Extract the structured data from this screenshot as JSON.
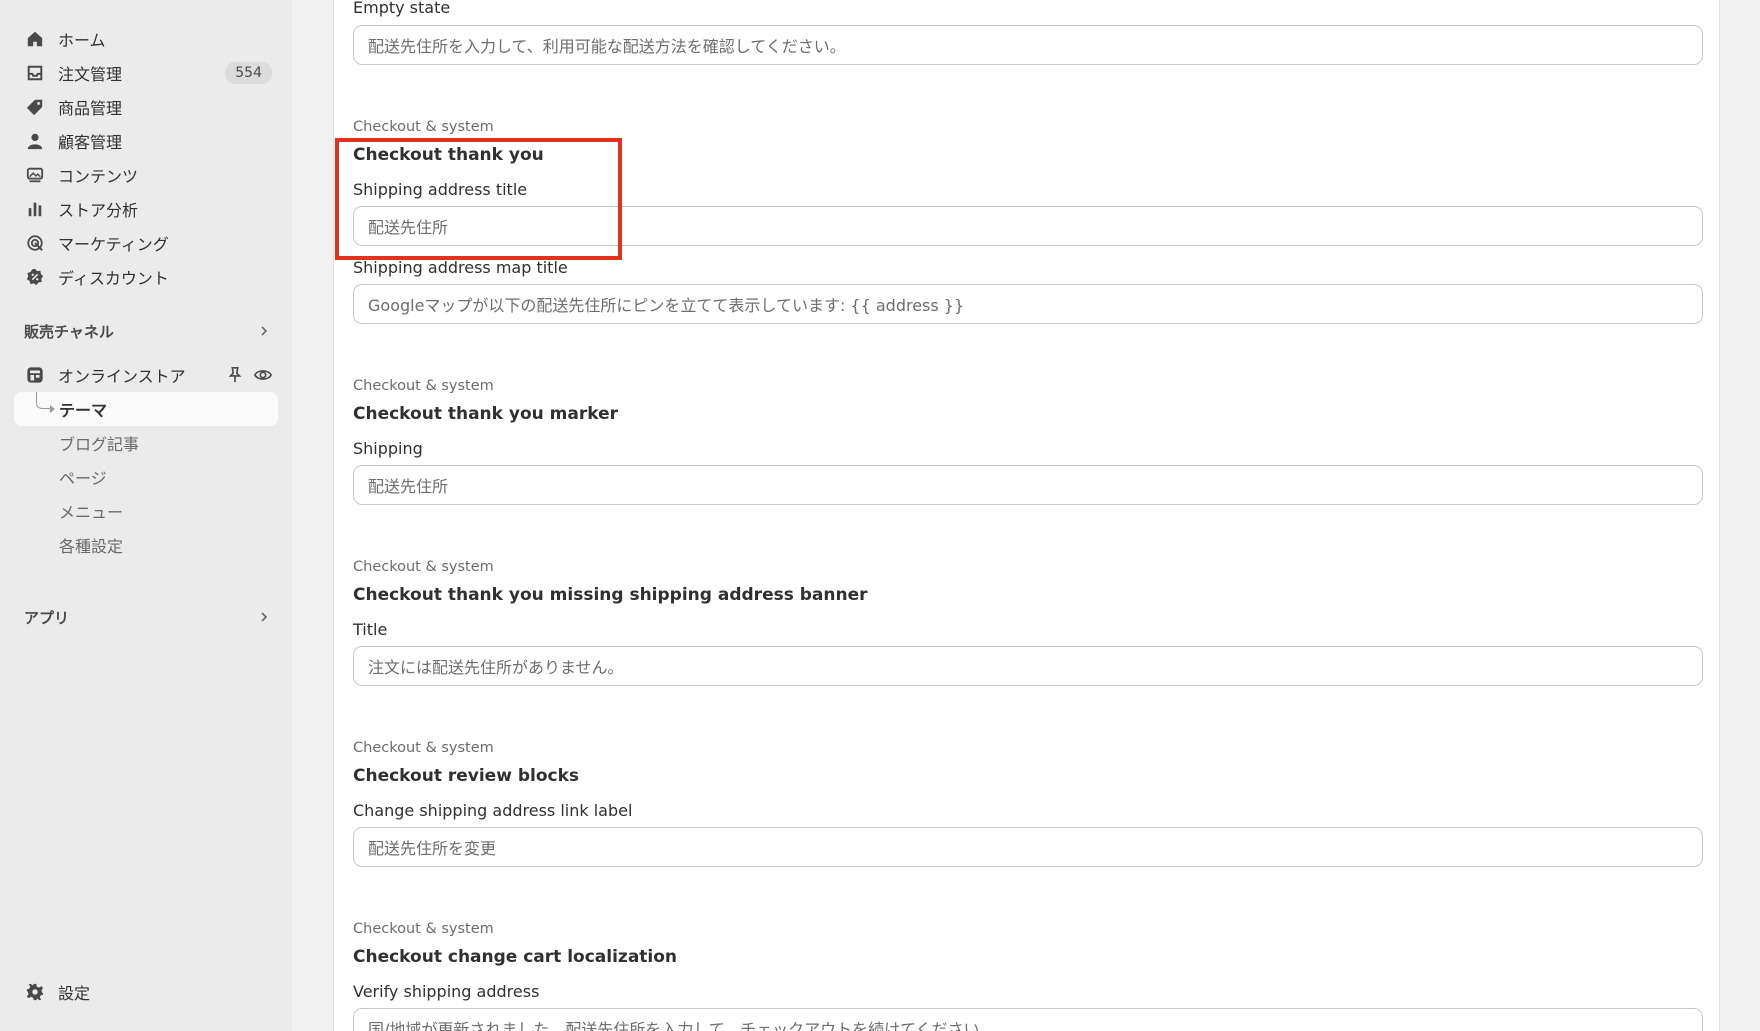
{
  "sidebar": {
    "nav": [
      {
        "label": "ホーム",
        "icon": "home-icon"
      },
      {
        "label": "注文管理",
        "icon": "inbox-icon",
        "badge": "554"
      },
      {
        "label": "商品管理",
        "icon": "tag-icon"
      },
      {
        "label": "顧客管理",
        "icon": "person-icon"
      },
      {
        "label": "コンテンツ",
        "icon": "content-icon"
      },
      {
        "label": "ストア分析",
        "icon": "bar-chart-icon"
      },
      {
        "label": "マーケティング",
        "icon": "target-icon"
      },
      {
        "label": "ディスカウント",
        "icon": "discount-icon"
      }
    ],
    "sales_channels": {
      "label": "販売チャネル",
      "online_store": "オンラインストア",
      "sub_items": [
        "テーマ",
        "ブログ記事",
        "ページ",
        "メニュー",
        "各種設定"
      ]
    },
    "apps_label": "アプリ",
    "settings_label": "設定"
  },
  "main": {
    "top_field": {
      "label": "Empty state",
      "value": "配送先住所を入力して、利用可能な配送方法を確認してください。"
    },
    "groups": [
      {
        "category": "Checkout & system",
        "title": "Checkout thank you",
        "fields": [
          {
            "label": "Shipping address title",
            "value": "配送先住所"
          },
          {
            "label": "Shipping address map title",
            "value": "Googleマップが以下の配送先住所にピンを立てて表示しています: {{ address }}"
          }
        ]
      },
      {
        "category": "Checkout & system",
        "title": "Checkout thank you marker",
        "fields": [
          {
            "label": "Shipping",
            "value": "配送先住所"
          }
        ]
      },
      {
        "category": "Checkout & system",
        "title": "Checkout thank you missing shipping address banner",
        "fields": [
          {
            "label": "Title",
            "value": "注文には配送先住所がありません。"
          }
        ]
      },
      {
        "category": "Checkout & system",
        "title": "Checkout review blocks",
        "fields": [
          {
            "label": "Change shipping address link label",
            "value": "配送先住所を変更"
          }
        ]
      },
      {
        "category": "Checkout & system",
        "title": "Checkout change cart localization",
        "fields": [
          {
            "label": "Verify shipping address",
            "value": "国/地域が更新されました。配送先住所を入力して、チェックアウトを続けてください。"
          }
        ]
      }
    ]
  },
  "colors": {
    "highlight": "#e3311d",
    "sidebar_bg": "#ebebeb",
    "panel_bg": "#ffffff"
  }
}
